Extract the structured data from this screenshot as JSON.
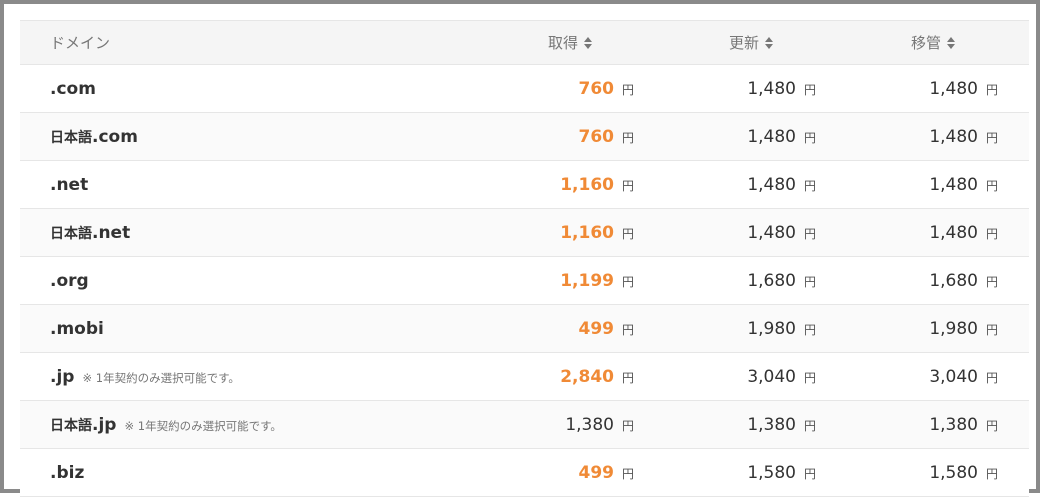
{
  "header": {
    "domain": "ドメイン",
    "registration": "取得",
    "renewal": "更新",
    "transfer": "移管"
  },
  "currency": "円",
  "colors": {
    "highlight_price": "#f08a36",
    "text": "#333333",
    "header_bg": "#f5f5f5"
  },
  "rows": [
    {
      "prefix": "",
      "tld": ".com",
      "note": "",
      "registration": "760",
      "registration_highlight": true,
      "renewal": "1,480",
      "transfer": "1,480"
    },
    {
      "prefix": "日本語",
      "tld": ".com",
      "note": "",
      "registration": "760",
      "registration_highlight": true,
      "renewal": "1,480",
      "transfer": "1,480"
    },
    {
      "prefix": "",
      "tld": ".net",
      "note": "",
      "registration": "1,160",
      "registration_highlight": true,
      "renewal": "1,480",
      "transfer": "1,480"
    },
    {
      "prefix": "日本語",
      "tld": ".net",
      "note": "",
      "registration": "1,160",
      "registration_highlight": true,
      "renewal": "1,480",
      "transfer": "1,480"
    },
    {
      "prefix": "",
      "tld": ".org",
      "note": "",
      "registration": "1,199",
      "registration_highlight": true,
      "renewal": "1,680",
      "transfer": "1,680"
    },
    {
      "prefix": "",
      "tld": ".mobi",
      "note": "",
      "registration": "499",
      "registration_highlight": true,
      "renewal": "1,980",
      "transfer": "1,980"
    },
    {
      "prefix": "",
      "tld": ".jp",
      "note": "※ 1年契約のみ選択可能です。",
      "registration": "2,840",
      "registration_highlight": true,
      "renewal": "3,040",
      "transfer": "3,040"
    },
    {
      "prefix": "日本語",
      "tld": ".jp",
      "note": "※ 1年契約のみ選択可能です。",
      "registration": "1,380",
      "registration_highlight": false,
      "renewal": "1,380",
      "transfer": "1,380"
    },
    {
      "prefix": "",
      "tld": ".biz",
      "note": "",
      "registration": "499",
      "registration_highlight": true,
      "renewal": "1,580",
      "transfer": "1,580"
    }
  ]
}
